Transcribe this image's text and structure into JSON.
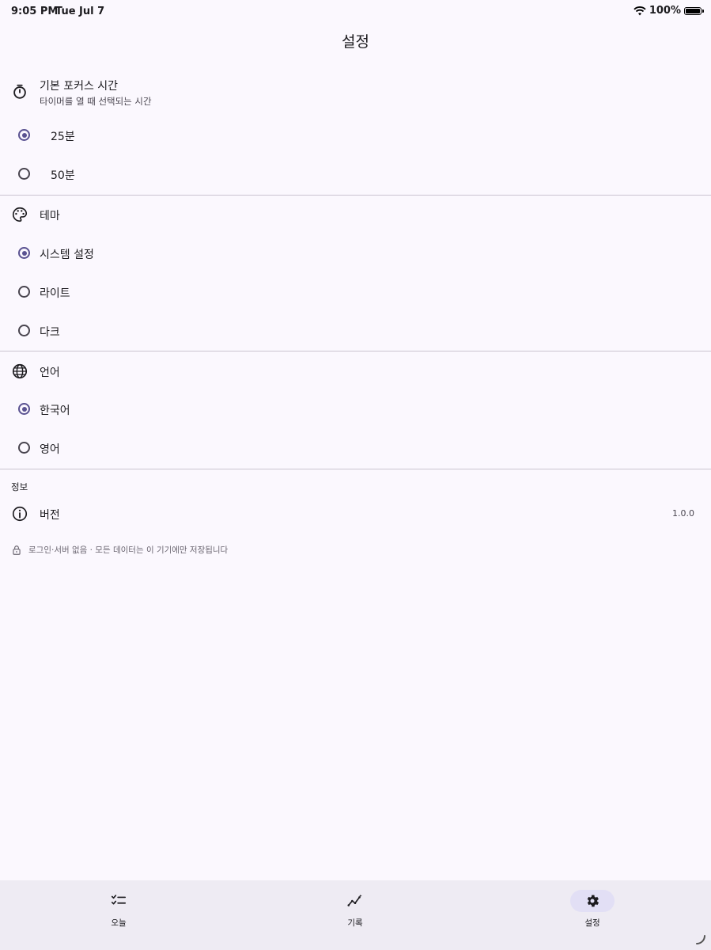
{
  "status_bar": {
    "time": "9:05 PM",
    "date": "Tue Jul 7",
    "battery_percent": "100%",
    "icons": [
      "wifi-icon",
      "battery-icon"
    ]
  },
  "page_title": "설정",
  "focus_section": {
    "label": "기본 포커스 시간",
    "subtitle": "타이머를 열 때 선택되는 시간",
    "icon": "timer-icon",
    "options": [
      {
        "label": "25분",
        "selected": true
      },
      {
        "label": "50분",
        "selected": false
      }
    ]
  },
  "theme_section": {
    "label": "테마",
    "icon": "palette-icon",
    "options": [
      {
        "label": "시스템 설정",
        "selected": true
      },
      {
        "label": "라이트",
        "selected": false
      },
      {
        "label": "다크",
        "selected": false
      }
    ]
  },
  "language_section": {
    "label": "언어",
    "icon": "globe-icon",
    "options": [
      {
        "label": "한국어",
        "selected": true
      },
      {
        "label": "영어",
        "selected": false
      }
    ]
  },
  "info_section": {
    "header": "정보",
    "version_label": "버전",
    "version_value": "1.0.0",
    "version_icon": "info-icon",
    "notice": "로그인·서버 없음 · 모든 데이터는 이 기기에만 저장됩니다",
    "notice_icon": "lock-icon"
  },
  "bottom_nav": [
    {
      "label": "오늘",
      "icon": "checklist-icon",
      "active": false
    },
    {
      "label": "기록",
      "icon": "insights-icon",
      "active": false
    },
    {
      "label": "설정",
      "icon": "gear-icon",
      "active": true
    }
  ],
  "colors": {
    "background": "#fbf8fe",
    "accent": "#5a5291",
    "nav_background": "#eeebf3",
    "nav_active_pill": "#e2dff5",
    "divider": "#cac4d0"
  }
}
